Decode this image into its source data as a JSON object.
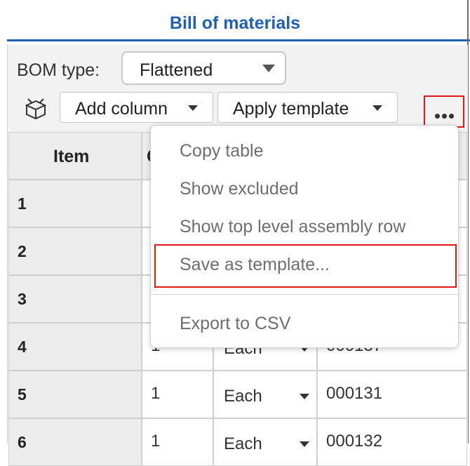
{
  "header": {
    "title": "Bill of materials"
  },
  "bom": {
    "label": "BOM type:",
    "selected": "Flattened"
  },
  "toolbar": {
    "icon": "export-box-icon",
    "add_column": "Add column",
    "apply_template": "Apply template",
    "more_icon": "more-horizontal-icon"
  },
  "table": {
    "columns": [
      "Item",
      "Q"
    ],
    "rows": [
      {
        "item": "1",
        "qty": "",
        "unit": "",
        "part": ""
      },
      {
        "item": "2",
        "qty": "",
        "unit": "",
        "part": ""
      },
      {
        "item": "3",
        "qty": "",
        "unit": "",
        "part": ""
      },
      {
        "item": "4",
        "qty": "1",
        "unit": "Each",
        "part": "000137"
      },
      {
        "item": "5",
        "qty": "1",
        "unit": "Each",
        "part": "000131"
      },
      {
        "item": "6",
        "qty": "1",
        "unit": "Each",
        "part": "000132"
      }
    ]
  },
  "menu": {
    "items": [
      "Copy table",
      "Show excluded",
      "Show top level assembly row",
      "Save as template...",
      "Export to CSV"
    ]
  },
  "colors": {
    "accent": "#1f5fb4",
    "highlight": "#e01818"
  }
}
